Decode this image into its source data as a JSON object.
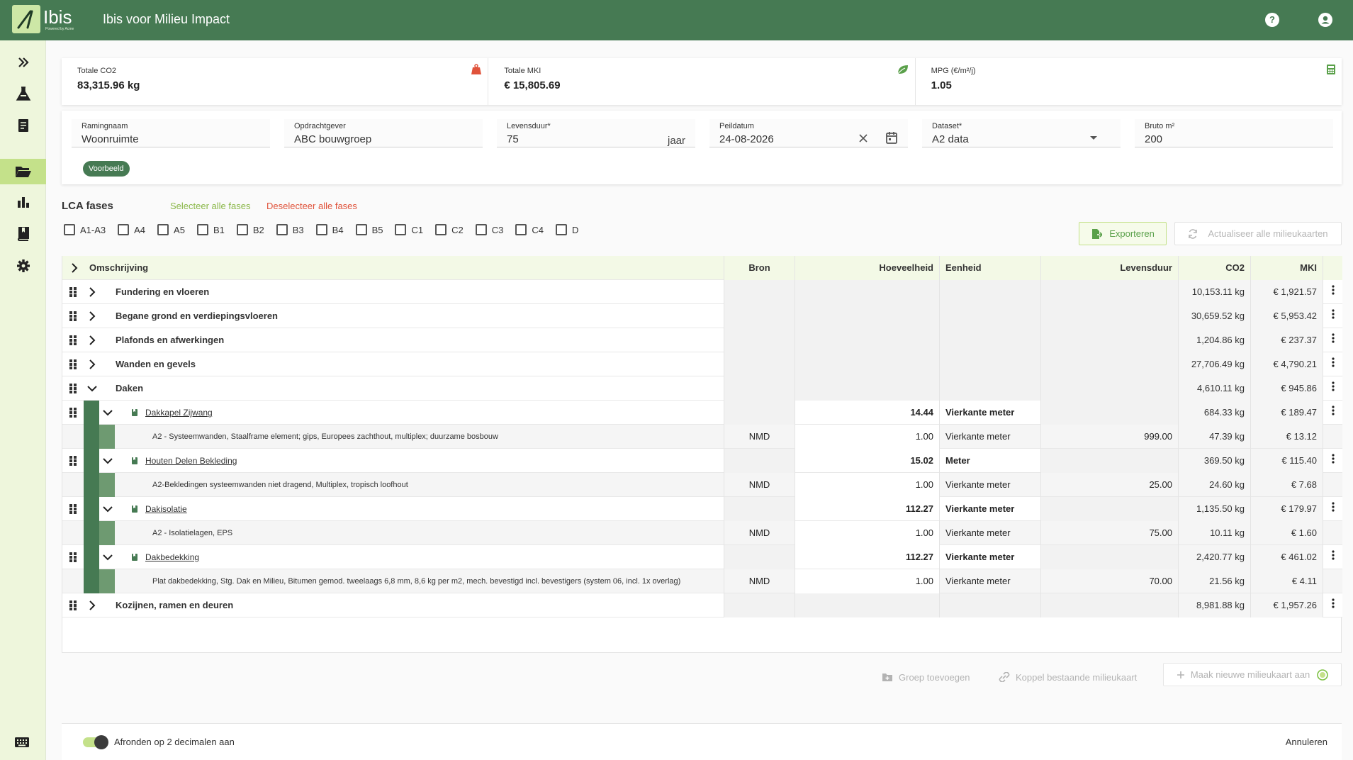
{
  "app": {
    "logo_text": "Ibis",
    "logo_sub": "Powered by Acme",
    "title": "Ibis voor Milieu Impact",
    "help_icon": "help-icon",
    "account_icon": "account-icon"
  },
  "sidebar": {
    "items": [
      {
        "icon": "double-chevron-right-icon"
      },
      {
        "icon": "flask-icon"
      },
      {
        "icon": "document-icon"
      },
      {
        "icon": "folder-open-icon",
        "active": true
      },
      {
        "icon": "bar-chart-icon"
      },
      {
        "icon": "book-icon"
      },
      {
        "icon": "gear-icon"
      }
    ],
    "keyboard_icon": "keyboard-icon"
  },
  "summary": {
    "co2_label": "Totale CO2",
    "co2_value": "83,315.96 kg",
    "mki_label": "Totale MKI",
    "mki_value": "€ 15,805.69",
    "mpg_label": "MPG (€/m²/j)",
    "mpg_value": "1.05",
    "colors": {
      "co2": "#e0533b",
      "mki": "#5aa04a",
      "mpg": "#5aa04a"
    }
  },
  "form": {
    "ramingnaam_label": "Ramingnaam",
    "ramingnaam_value": "Woonruimte",
    "opdrachtgever_label": "Opdrachtgever",
    "opdrachtgever_value": "ABC bouwgroep",
    "levensduur_label": "Levensduur*",
    "levensduur_value": "75",
    "levensduur_suffix": "jaar",
    "peildatum_label": "Peildatum",
    "peildatum_value": "24-08-2026",
    "dataset_label": "Dataset*",
    "dataset_value": "A2 data",
    "bruto_label": "Bruto m²",
    "bruto_value": "200",
    "badge": "Voorbeeld"
  },
  "lca": {
    "title": "LCA fases",
    "select_all": "Selecteer alle fases",
    "deselect_all": "Deselecteer alle fases",
    "phases": [
      "A1-A3",
      "A4",
      "A5",
      "B1",
      "B2",
      "B3",
      "B4",
      "B5",
      "C1",
      "C2",
      "C3",
      "C4",
      "D"
    ],
    "export_label": "Exporteren",
    "update_label": "Actualiseer alle milieukaarten"
  },
  "table": {
    "headers": {
      "omschrijving": "Omschrijving",
      "bron": "Bron",
      "hoeveelheid": "Hoeveelheid",
      "eenheid": "Eenheid",
      "levensduur": "Levensduur",
      "co2": "CO2",
      "mki": "MKI"
    },
    "rows": [
      {
        "type": "group",
        "name": "Fundering en vloeren",
        "co2": "10,153.11 kg",
        "mki": "€ 1,921.57"
      },
      {
        "type": "group",
        "name": "Begane grond en verdiepingsvloeren",
        "co2": "30,659.52 kg",
        "mki": "€ 5,953.42"
      },
      {
        "type": "group",
        "name": "Plafonds en afwerkingen",
        "co2": "1,204.86 kg",
        "mki": "€ 237.37"
      },
      {
        "type": "group",
        "name": "Wanden en gevels",
        "co2": "27,706.49 kg",
        "mki": "€ 4,790.21"
      },
      {
        "type": "group",
        "name": "Daken",
        "co2": "4,610.11 kg",
        "mki": "€ 945.86",
        "expanded": true
      },
      {
        "type": "sub",
        "name": "Dakkapel Zijwang",
        "hoeveelheid": "14.44",
        "eenheid": "Vierkante meter",
        "co2": "684.33 kg",
        "mki": "€ 189.47"
      },
      {
        "type": "mat",
        "name": "A2 - Systeemwanden, Staalframe element; gips, Europees zachthout, multiplex; duurzame bosbouw",
        "bron": "NMD",
        "hoeveelheid": "1.00",
        "eenheid": "Vierkante meter",
        "levensduur": "999.00",
        "co2": "47.39 kg",
        "mki": "€ 13.12"
      },
      {
        "type": "sub",
        "name": "Houten Delen Bekleding",
        "hoeveelheid": "15.02",
        "eenheid": "Meter",
        "co2": "369.50 kg",
        "mki": "€ 115.40"
      },
      {
        "type": "mat",
        "name": "A2-Bekledingen systeemwanden niet dragend, Multiplex, tropisch loofhout",
        "bron": "NMD",
        "hoeveelheid": "1.00",
        "eenheid": "Vierkante meter",
        "levensduur": "25.00",
        "co2": "24.60 kg",
        "mki": "€ 7.68"
      },
      {
        "type": "sub",
        "name": "Dakisolatie",
        "hoeveelheid": "112.27",
        "eenheid": "Vierkante meter",
        "co2": "1,135.50 kg",
        "mki": "€ 179.97"
      },
      {
        "type": "mat",
        "name": "A2 - Isolatielagen, EPS",
        "bron": "NMD",
        "hoeveelheid": "1.00",
        "eenheid": "Vierkante meter",
        "levensduur": "75.00",
        "co2": "10.11 kg",
        "mki": "€ 1.60"
      },
      {
        "type": "sub",
        "name": "Dakbedekking",
        "hoeveelheid": "112.27",
        "eenheid": "Vierkante meter",
        "co2": "2,420.77 kg",
        "mki": "€ 461.02"
      },
      {
        "type": "mat",
        "name": "Plat dakbedekking, Stg. Dak en Milieu, Bitumen gemod. tweelaags 6,8 mm, 8,6 kg per m2, mech. bevestigd incl. bevestigers (system 06, incl. 1x overlag)",
        "bron": "NMD",
        "hoeveelheid": "1.00",
        "eenheid": "Vierkante meter",
        "levensduur": "70.00",
        "co2": "21.56 kg",
        "mki": "€ 4.11"
      },
      {
        "type": "group",
        "name": "Kozijnen, ramen en deuren",
        "co2": "8,981.88 kg",
        "mki": "€ 1,957.26"
      }
    ]
  },
  "actions": {
    "add_group": "Groep toevoegen",
    "link_card": "Koppel bestaande milieukaart",
    "new_card": "Maak nieuwe milieukaart aan"
  },
  "bottom": {
    "toggle_label": "Afronden op 2 decimalen aan",
    "toggle_on": true,
    "cancel": "Annuleren"
  }
}
